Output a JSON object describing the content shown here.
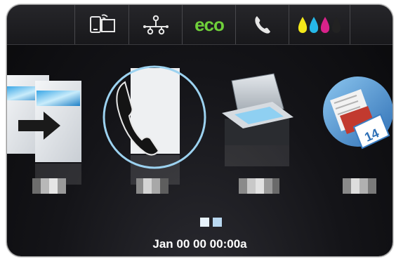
{
  "status_bar": {
    "items": [
      {
        "name": "wireless-direct-icon"
      },
      {
        "name": "network-icon"
      },
      {
        "name": "eco",
        "label": "eco"
      },
      {
        "name": "fax-status-icon"
      },
      {
        "name": "ink-levels-icon"
      }
    ],
    "ink_colors": [
      "#f3e81a",
      "#26b8e8",
      "#d9228a",
      "#222222"
    ]
  },
  "apps": [
    {
      "id": "copy",
      "icon": "copy-icon"
    },
    {
      "id": "fax",
      "icon": "fax-icon",
      "selected": true
    },
    {
      "id": "scan",
      "icon": "scan-icon"
    },
    {
      "id": "calendar",
      "icon": "calendar-icon",
      "badge": "14"
    }
  ],
  "pager": {
    "pages": 2,
    "current": 1
  },
  "footer": {
    "datetime": "Jan 00 00 00:00a"
  },
  "colors": {
    "accent_ring": "#9cd2f0",
    "eco_green": "#6fcf3a",
    "panel_bg": "#141418"
  }
}
